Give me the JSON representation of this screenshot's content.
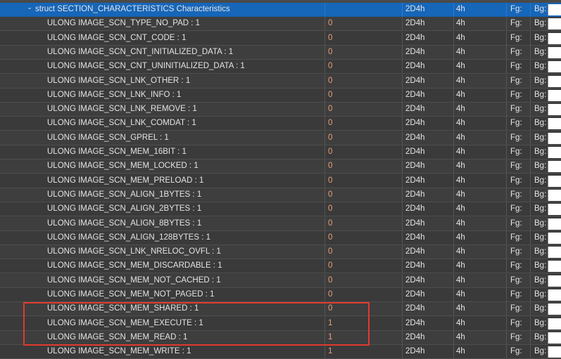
{
  "header_row": {
    "expand_icon": "chevron-down",
    "name": "struct SECTION_CHARACTERISTICS Characteristics",
    "value": "",
    "start": "2D4h",
    "size": "4h",
    "fg": "Fg:",
    "bg": "Bg:"
  },
  "rows": [
    {
      "name": "ULONG IMAGE_SCN_TYPE_NO_PAD : 1",
      "value": "0",
      "start": "2D4h",
      "size": "4h",
      "fg": "Fg:",
      "bg": "Bg:"
    },
    {
      "name": "ULONG IMAGE_SCN_CNT_CODE : 1",
      "value": "0",
      "start": "2D4h",
      "size": "4h",
      "fg": "Fg:",
      "bg": "Bg:"
    },
    {
      "name": "ULONG IMAGE_SCN_CNT_INITIALIZED_DATA : 1",
      "value": "0",
      "start": "2D4h",
      "size": "4h",
      "fg": "Fg:",
      "bg": "Bg:"
    },
    {
      "name": "ULONG IMAGE_SCN_CNT_UNINITIALIZED_DATA : 1",
      "value": "0",
      "start": "2D4h",
      "size": "4h",
      "fg": "Fg:",
      "bg": "Bg:"
    },
    {
      "name": "ULONG IMAGE_SCN_LNK_OTHER : 1",
      "value": "0",
      "start": "2D4h",
      "size": "4h",
      "fg": "Fg:",
      "bg": "Bg:"
    },
    {
      "name": "ULONG IMAGE_SCN_LNK_INFO : 1",
      "value": "0",
      "start": "2D4h",
      "size": "4h",
      "fg": "Fg:",
      "bg": "Bg:"
    },
    {
      "name": "ULONG IMAGE_SCN_LNK_REMOVE : 1",
      "value": "0",
      "start": "2D4h",
      "size": "4h",
      "fg": "Fg:",
      "bg": "Bg:"
    },
    {
      "name": "ULONG IMAGE_SCN_LNK_COMDAT : 1",
      "value": "0",
      "start": "2D4h",
      "size": "4h",
      "fg": "Fg:",
      "bg": "Bg:"
    },
    {
      "name": "ULONG IMAGE_SCN_GPREL : 1",
      "value": "0",
      "start": "2D4h",
      "size": "4h",
      "fg": "Fg:",
      "bg": "Bg:"
    },
    {
      "name": "ULONG IMAGE_SCN_MEM_16BIT : 1",
      "value": "0",
      "start": "2D4h",
      "size": "4h",
      "fg": "Fg:",
      "bg": "Bg:"
    },
    {
      "name": "ULONG IMAGE_SCN_MEM_LOCKED : 1",
      "value": "0",
      "start": "2D4h",
      "size": "4h",
      "fg": "Fg:",
      "bg": "Bg:"
    },
    {
      "name": "ULONG IMAGE_SCN_MEM_PRELOAD : 1",
      "value": "0",
      "start": "2D4h",
      "size": "4h",
      "fg": "Fg:",
      "bg": "Bg:"
    },
    {
      "name": "ULONG IMAGE_SCN_ALIGN_1BYTES : 1",
      "value": "0",
      "start": "2D4h",
      "size": "4h",
      "fg": "Fg:",
      "bg": "Bg:"
    },
    {
      "name": "ULONG IMAGE_SCN_ALIGN_2BYTES : 1",
      "value": "0",
      "start": "2D4h",
      "size": "4h",
      "fg": "Fg:",
      "bg": "Bg:"
    },
    {
      "name": "ULONG IMAGE_SCN_ALIGN_8BYTES : 1",
      "value": "0",
      "start": "2D4h",
      "size": "4h",
      "fg": "Fg:",
      "bg": "Bg:"
    },
    {
      "name": "ULONG IMAGE_SCN_ALIGN_128BYTES : 1",
      "value": "0",
      "start": "2D4h",
      "size": "4h",
      "fg": "Fg:",
      "bg": "Bg:"
    },
    {
      "name": "ULONG IMAGE_SCN_LNK_NRELOC_OVFL : 1",
      "value": "0",
      "start": "2D4h",
      "size": "4h",
      "fg": "Fg:",
      "bg": "Bg:"
    },
    {
      "name": "ULONG IMAGE_SCN_MEM_DISCARDABLE : 1",
      "value": "0",
      "start": "2D4h",
      "size": "4h",
      "fg": "Fg:",
      "bg": "Bg:"
    },
    {
      "name": "ULONG IMAGE_SCN_MEM_NOT_CACHED : 1",
      "value": "0",
      "start": "2D4h",
      "size": "4h",
      "fg": "Fg:",
      "bg": "Bg:"
    },
    {
      "name": "ULONG IMAGE_SCN_MEM_NOT_PAGED : 1",
      "value": "0",
      "start": "2D4h",
      "size": "4h",
      "fg": "Fg:",
      "bg": "Bg:"
    },
    {
      "name": "ULONG IMAGE_SCN_MEM_SHARED : 1",
      "value": "0",
      "start": "2D4h",
      "size": "4h",
      "fg": "Fg:",
      "bg": "Bg:"
    },
    {
      "name": "ULONG IMAGE_SCN_MEM_EXECUTE : 1",
      "value": "1",
      "start": "2D4h",
      "size": "4h",
      "fg": "Fg:",
      "bg": "Bg:"
    },
    {
      "name": "ULONG IMAGE_SCN_MEM_READ : 1",
      "value": "1",
      "start": "2D4h",
      "size": "4h",
      "fg": "Fg:",
      "bg": "Bg:"
    },
    {
      "name": "ULONG IMAGE_SCN_MEM_WRITE : 1",
      "value": "1",
      "start": "2D4h",
      "size": "4h",
      "fg": "Fg:",
      "bg": "Bg:"
    }
  ],
  "colors": {
    "selected_row": "#1666b9",
    "value_zero": "#e8a07a",
    "value_one": "#e8a07a",
    "highlight_box": "#e03a2e",
    "bg_swatch": "#ffffff"
  }
}
